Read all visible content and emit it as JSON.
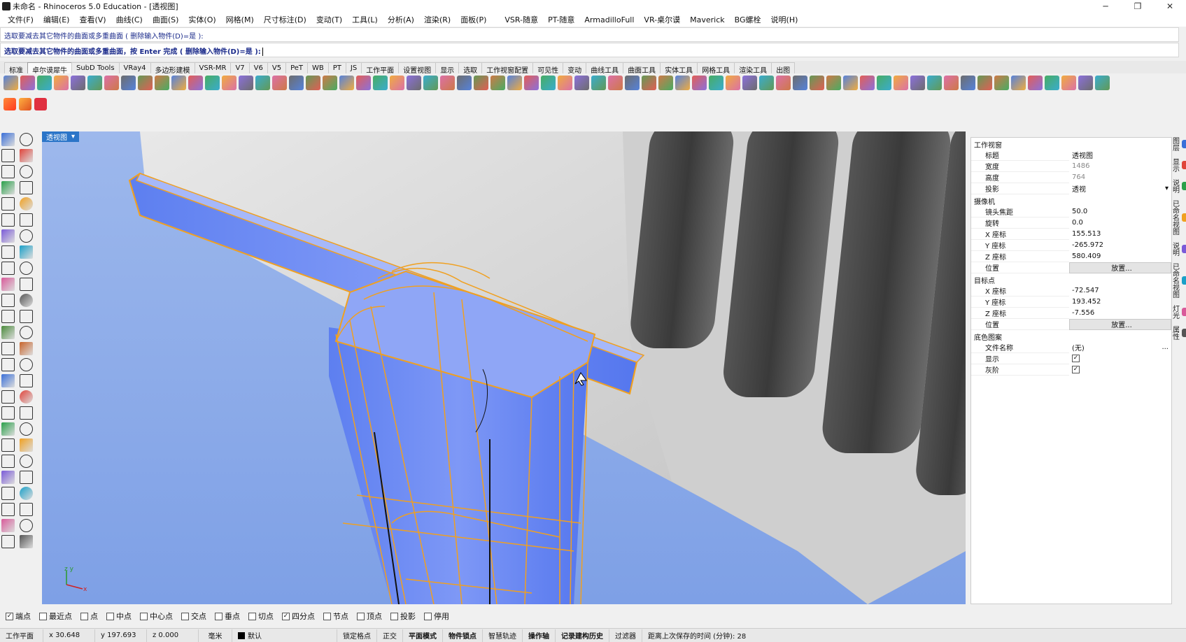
{
  "titlebar": {
    "title": "未命名 - Rhinoceros 5.0 Education - [透视图]"
  },
  "menu": [
    "文件(F)",
    "编辑(E)",
    "查看(V)",
    "曲线(C)",
    "曲面(S)",
    "实体(O)",
    "网格(M)",
    "尺寸标注(D)",
    "变动(T)",
    "工具(L)",
    "分析(A)",
    "渲染(R)",
    "面板(P)",
    "VSR-随意",
    "PT-随意",
    "ArmadilloFull",
    "VR-桌尔谟",
    "Maverick",
    "BG螺栓",
    "说明(H)"
  ],
  "command": {
    "history": "选取要减去其它物件的曲面或多重曲面 ( 删除输入物件(D)=是 ):",
    "prompt": "选取要减去其它物件的曲面或多重曲面，按 Enter 完成 ( 删除输入物件(D)=是 ):"
  },
  "tabs": [
    "标准",
    "卓尔谟犀牛",
    "SubD Tools",
    "VRay4",
    "多边形建模",
    "VSR-MR",
    "V7",
    "V6",
    "V5",
    "PeT",
    "WB",
    "PT",
    "JS",
    "工作平面",
    "设置视图",
    "显示",
    "选取",
    "工作视窗配置",
    "可见性",
    "变动",
    "曲线工具",
    "曲面工具",
    "实体工具",
    "网格工具",
    "渲染工具",
    "出图"
  ],
  "viewport": {
    "label": "透视图"
  },
  "panel": {
    "sec_viewport": "工作视窗",
    "title_k": "标题",
    "title_v": "透视图",
    "width_k": "宽度",
    "width_v": "1486",
    "height_k": "高度",
    "height_v": "764",
    "proj_k": "投影",
    "proj_v": "透视",
    "sec_camera": "摄像机",
    "focal_k": "镜头焦距",
    "focal_v": "50.0",
    "rot_k": "旋转",
    "rot_v": "0.0",
    "cx_k": "X 座标",
    "cx_v": "155.513",
    "cy_k": "Y 座标",
    "cy_v": "-265.972",
    "cz_k": "Z 座标",
    "cz_v": "580.409",
    "cpos_k": "位置",
    "cpos_v": "放置...",
    "sec_target": "目标点",
    "tx_k": "X 座标",
    "tx_v": "-72.547",
    "ty_k": "Y 座标",
    "ty_v": "193.452",
    "tz_k": "Z 座标",
    "tz_v": "-7.556",
    "tpos_k": "位置",
    "tpos_v": "放置...",
    "sec_bg": "底色图案",
    "file_k": "文件名称",
    "file_v": "(无)",
    "show_k": "显示",
    "gray_k": "灰阶"
  },
  "right_tabs": [
    "图层",
    "显示",
    "说明",
    "已命名视图",
    "说明",
    "已命名视图",
    "灯光",
    "属性"
  ],
  "osnap": [
    {
      "label": "端点",
      "checked": true
    },
    {
      "label": "最近点",
      "checked": false
    },
    {
      "label": "点",
      "checked": false
    },
    {
      "label": "中点",
      "checked": false
    },
    {
      "label": "中心点",
      "checked": false
    },
    {
      "label": "交点",
      "checked": false
    },
    {
      "label": "垂点",
      "checked": false
    },
    {
      "label": "切点",
      "checked": false
    },
    {
      "label": "四分点",
      "checked": true
    },
    {
      "label": "节点",
      "checked": false
    },
    {
      "label": "顶点",
      "checked": false
    },
    {
      "label": "投影",
      "checked": false
    },
    {
      "label": "停用",
      "checked": false
    }
  ],
  "status": {
    "cplane": "工作平面",
    "x": "x 30.648",
    "y": "y 197.693",
    "z": "z 0.000",
    "unit": "毫米",
    "layer": "默认",
    "grid_snap": "锁定格点",
    "ortho": "正交",
    "planar": "平面模式",
    "osnap": "物件锁点",
    "smarttrack": "智慧轨迹",
    "gumball": "操作轴",
    "history": "记录建构历史",
    "filter": "过滤器",
    "autosave": "距离上次保存的时间 (分钟): 28"
  },
  "colors": {
    "accent": "#2b75c8",
    "wire": "#f0a020",
    "surface": "#6f8ff5"
  }
}
